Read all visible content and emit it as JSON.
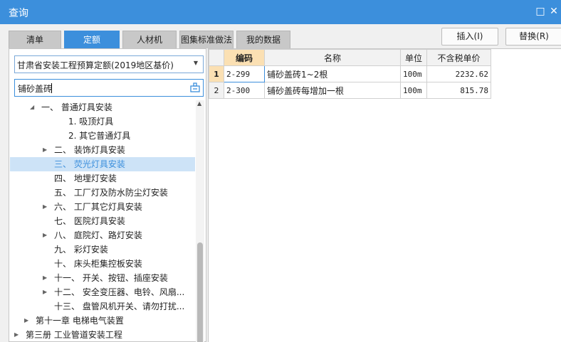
{
  "window": {
    "title": "查询",
    "maximize_icon": "□",
    "close_icon": "✕"
  },
  "tabs": [
    {
      "label": "清单",
      "active": false
    },
    {
      "label": "定额",
      "active": true
    },
    {
      "label": "人材机",
      "active": false
    },
    {
      "label": "图集标准做法",
      "active": false
    },
    {
      "label": "我的数据",
      "active": false
    }
  ],
  "buttons": {
    "insert": "插入(I)",
    "replace": "替换(R)"
  },
  "left": {
    "library_select": "甘肃省安装工程预算定额(2019地区基价)",
    "search_value": "铺砂盖砖",
    "tree": [
      {
        "label": "一、 普通灯具安装",
        "indent": 44,
        "arrow": "◢",
        "selected": false
      },
      {
        "label": "1. 吸顶灯具",
        "indent": 82,
        "arrow": "",
        "selected": false
      },
      {
        "label": "2. 其它普通灯具",
        "indent": 82,
        "arrow": "",
        "selected": false
      },
      {
        "label": "二、 装饰灯具安装",
        "indent": 62,
        "arrow": "▶",
        "selected": false
      },
      {
        "label": "三、 荧光灯具安装",
        "indent": 62,
        "arrow": "",
        "selected": true
      },
      {
        "label": "四、 地埋灯安装",
        "indent": 62,
        "arrow": "",
        "selected": false
      },
      {
        "label": "五、 工厂灯及防水防尘灯安装",
        "indent": 62,
        "arrow": "",
        "selected": false
      },
      {
        "label": "六、 工厂其它灯具安装",
        "indent": 62,
        "arrow": "▶",
        "selected": false
      },
      {
        "label": "七、 医院灯具安装",
        "indent": 62,
        "arrow": "",
        "selected": false
      },
      {
        "label": "八、 庭院灯、路灯安装",
        "indent": 62,
        "arrow": "▶",
        "selected": false
      },
      {
        "label": "九、 彩灯安装",
        "indent": 62,
        "arrow": "",
        "selected": false
      },
      {
        "label": "十、 床头柜集控板安装",
        "indent": 62,
        "arrow": "",
        "selected": false
      },
      {
        "label": "十一、 开关、按钮、插座安装",
        "indent": 62,
        "arrow": "▶",
        "selected": false
      },
      {
        "label": "十二、 安全变压器、电铃、风扇...",
        "indent": 62,
        "arrow": "▶",
        "selected": false
      },
      {
        "label": "十三、 盘管风机开关、请勿打扰...",
        "indent": 62,
        "arrow": "",
        "selected": false
      },
      {
        "label": "第十一章 电梯电气装置",
        "indent": 36,
        "arrow": "▶",
        "selected": false
      },
      {
        "label": "第三册 工业管道安装工程",
        "indent": 22,
        "arrow": "▶",
        "selected": false
      }
    ]
  },
  "grid": {
    "columns": [
      "编码",
      "名称",
      "单位",
      "不含税单价"
    ],
    "rows": [
      {
        "num": "1",
        "code": "2-299",
        "name": "铺砂盖砖1~2根",
        "unit": "100m",
        "price": "2232.62"
      },
      {
        "num": "2",
        "code": "2-300",
        "name": "铺砂盖砖每增加一根",
        "unit": "100m",
        "price": "815.78"
      }
    ]
  }
}
